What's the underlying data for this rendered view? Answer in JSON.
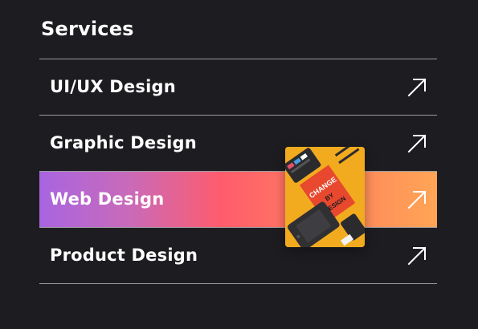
{
  "section": {
    "title": "Services"
  },
  "services": [
    {
      "label": "UI/UX Design",
      "icon": "arrow-up-right-icon",
      "active": false
    },
    {
      "label": "Graphic Design",
      "icon": "arrow-up-right-icon",
      "active": false
    },
    {
      "label": "Web Design",
      "icon": "arrow-up-right-icon",
      "active": true
    },
    {
      "label": "Product Design",
      "icon": "arrow-up-right-icon",
      "active": false
    }
  ],
  "preview": {
    "poster_text_1": "CHANGE",
    "poster_text_2": "BY",
    "poster_text_3": "DESIGN"
  },
  "colors": {
    "background": "#1d1c20",
    "active_gradient_start": "#a865e0",
    "active_gradient_mid": "#ff5c6c",
    "active_gradient_end": "#ffa555",
    "divider": "#bcbcc0"
  }
}
